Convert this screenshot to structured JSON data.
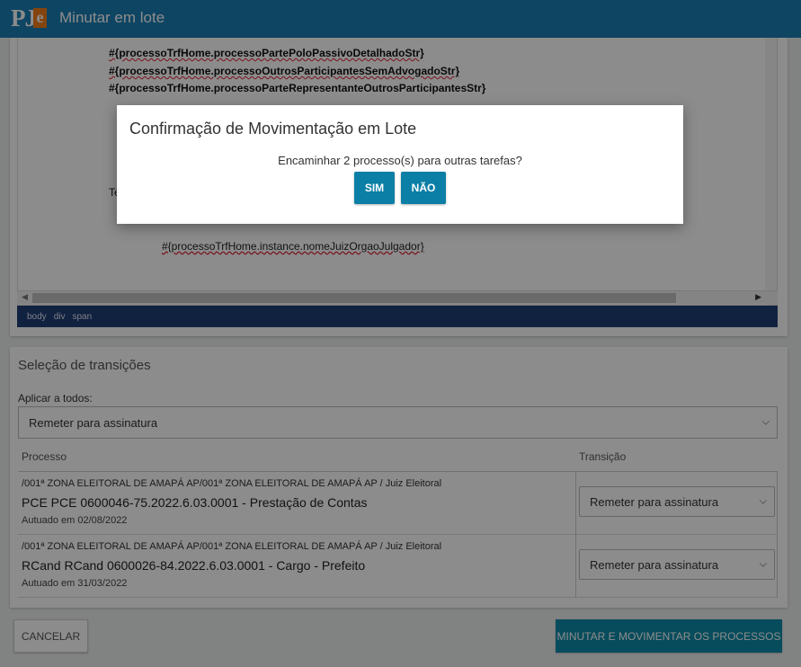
{
  "header": {
    "logo_text": "PJe",
    "title": "Minutar em lote"
  },
  "editor": {
    "lines": [
      "#{processoTrfHome.processoPartePoloPassivoDetalhadoStr}",
      "#{processoTrfHome.processoOutrosParticipantesSemAdvogadoStr}",
      "#{processoTrfHome.processoParteRepresentanteOutrosParticipantesStr}"
    ],
    "partial_text": "Te",
    "judge_line": "#{processoTrfHome.instance.nomeJuizOrgaoJulgador}",
    "status_path": [
      "body",
      "div",
      "span"
    ]
  },
  "selection": {
    "heading": "Seleção de transições",
    "apply_label": "Aplicar a todos:",
    "apply_value": "Remeter para assinatura",
    "col_process": "Processo",
    "col_transition": "Transição",
    "rows": [
      {
        "org": "/001ª ZONA ELEITORAL DE AMAPÁ AP/001ª ZONA ELEITORAL DE AMAPÁ AP / Juiz Eleitoral",
        "process": "PCE PCE 0600046-75.2022.6.03.0001 - Prestação de Contas",
        "date": "Autuado em 02/08/2022",
        "transition": "Remeter para assinatura"
      },
      {
        "org": "/001ª ZONA ELEITORAL DE AMAPÁ AP/001ª ZONA ELEITORAL DE AMAPÁ AP / Juiz Eleitoral",
        "process": "RCand RCand 0600026-84.2022.6.03.0001 - Cargo - Prefeito",
        "date": "Autuado em 31/03/2022",
        "transition": "Remeter para assinatura"
      }
    ]
  },
  "footer": {
    "cancel": "CANCELAR",
    "submit": "MINUTAR E MOVIMENTAR OS PROCESSOS"
  },
  "modal": {
    "title": "Confirmação de Movimentação em Lote",
    "message": "Encaminhar 2 processo(s) para outras tarefas?",
    "yes": "SIM",
    "no": "NÃO"
  },
  "colors": {
    "header_bg": "#1b7fb5",
    "logo_accent": "#f07d1a",
    "primary_button": "#0e8aa8",
    "status_bar": "#1f3c75"
  }
}
